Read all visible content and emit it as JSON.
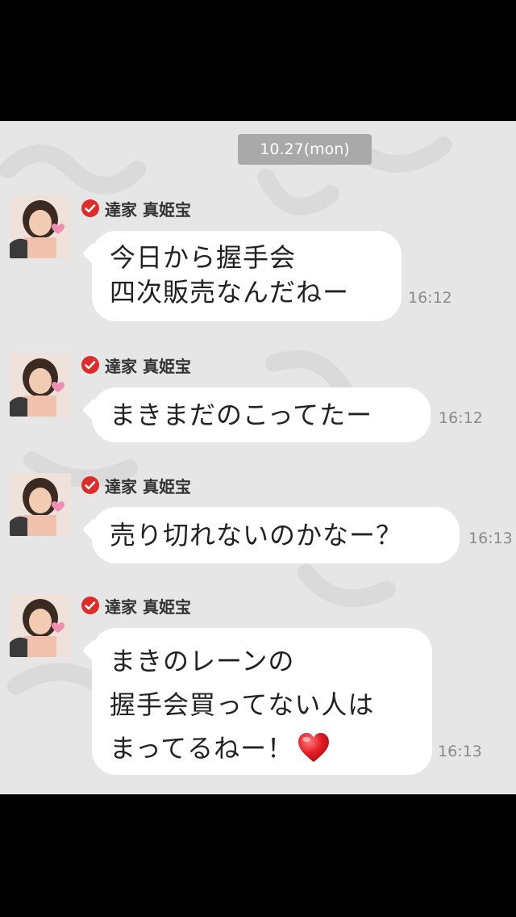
{
  "date_divider": "10.27(mon)",
  "messages": [
    {
      "sender": "達家 真姫宝",
      "lines": [
        "今日から握手会",
        "四次販売なんだねー"
      ],
      "time": "16:12"
    },
    {
      "sender": "達家 真姫宝",
      "lines": [
        "まきまだのこってたー"
      ],
      "time": "16:12"
    },
    {
      "sender": "達家 真姫宝",
      "lines": [
        "売り切れないのかなー？"
      ],
      "time": "16:13"
    },
    {
      "sender": "達家 真姫宝",
      "lines": [
        "まきのレーンの",
        "握手会買ってない人は",
        "まってるねー！"
      ],
      "emoji": "heart-icon",
      "time": "16:13"
    }
  ],
  "colors": {
    "chat_background": "#e6e6e6",
    "bubble": "#ffffff",
    "date_pill": "#a9a9a9",
    "verified_badge": "#e02b2b",
    "heart": "#e31b23"
  }
}
